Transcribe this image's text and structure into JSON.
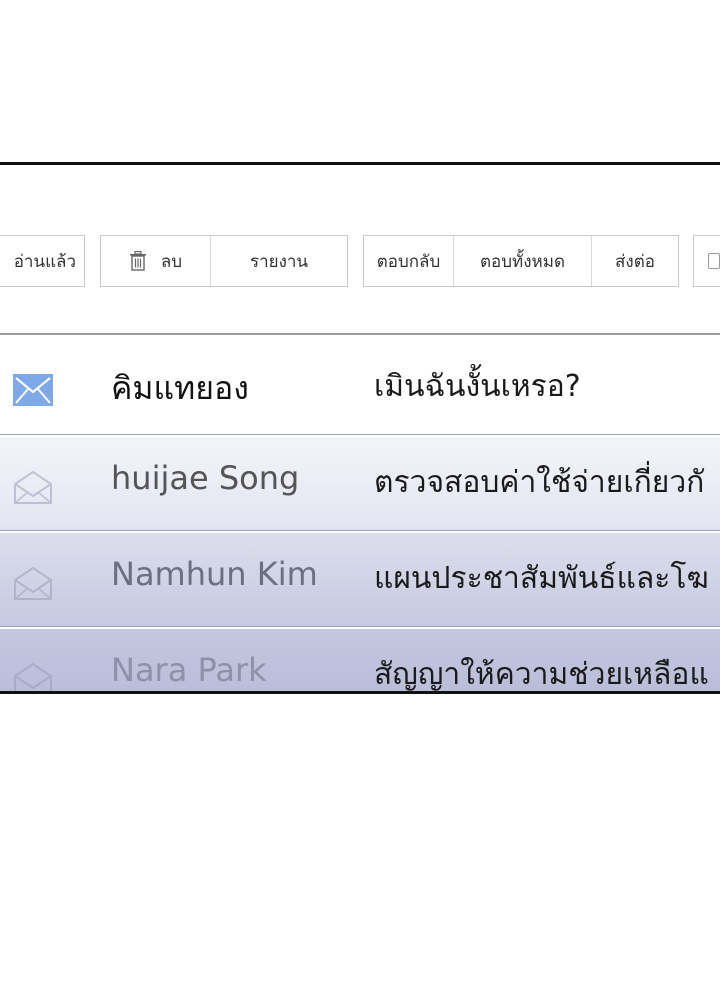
{
  "toolbar": {
    "mark_read": "อ่านแล้ว",
    "delete": "ลบ",
    "report": "รายงาน",
    "reply": "ตอบกลับ",
    "reply_all": "ตอบทั้งหมด",
    "forward": "ส่งต่อ"
  },
  "emails": [
    {
      "sender": "คิมแทยอง",
      "subject": "เมินฉันงั้นเหรอ?",
      "state": "unread",
      "icon": "envelope-closed-icon"
    },
    {
      "sender": "huijae Song",
      "subject": "ตรวจสอบค่าใช้จ่ายเกี่ยวกั",
      "state": "read",
      "icon": "envelope-open-icon"
    },
    {
      "sender": "Namhun Kim",
      "subject": "แผนประชาสัมพันธ์และโฆ",
      "state": "read",
      "icon": "envelope-open-icon"
    },
    {
      "sender": "Nara Park",
      "subject": "สัญญาให้ความช่วยเหลือแ",
      "state": "read",
      "icon": "envelope-open-icon"
    }
  ],
  "colors": {
    "unread_icon": "#7aa6e6",
    "border": "#111111",
    "row_tint": "#c6c9e1"
  }
}
